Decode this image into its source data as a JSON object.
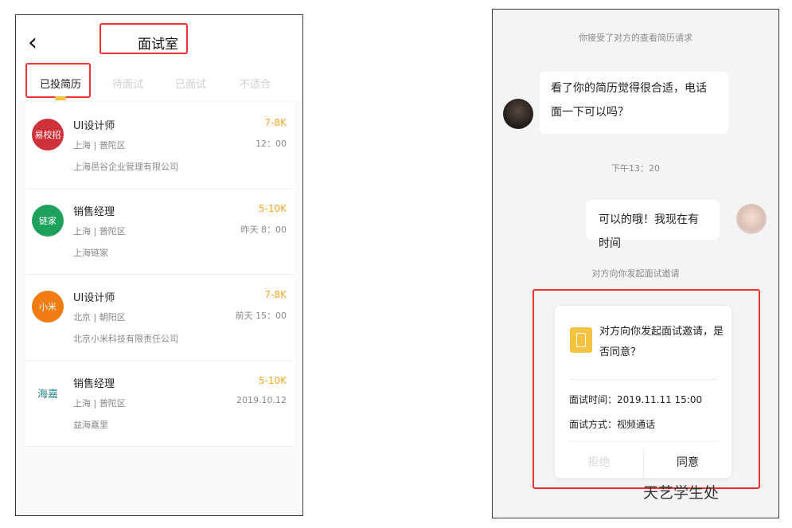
{
  "left_screen": {
    "back_icon": "chevron-left-icon",
    "title": "面试室",
    "tabs": [
      {
        "label": "已投简历",
        "active": true
      },
      {
        "label": "待面试",
        "active": false
      },
      {
        "label": "已面试",
        "active": false
      },
      {
        "label": "不适合",
        "active": false
      }
    ],
    "jobs": [
      {
        "title": "UI设计师",
        "salary": "7-8K",
        "location": "上海 | 普陀区",
        "time": "12：00",
        "company": "上海邑谷企业管理有限公司",
        "logo_text": "易校招",
        "logo_color": "#d0323a"
      },
      {
        "title": "销售经理",
        "salary": "5-10K",
        "location": "上海 | 普陀区",
        "time": "昨天 8：00",
        "company": "上海链家",
        "logo_text": "链家",
        "logo_color": "#1ea25b"
      },
      {
        "title": "UI设计师",
        "salary": "7-8K",
        "location": "北京 | 朝阳区",
        "time": "前天 15：00",
        "company": "北京小米科技有限责任公司",
        "logo_text": "小米",
        "logo_color": "#f07c12"
      },
      {
        "title": "销售经理",
        "salary": "5-10K",
        "location": "上海 | 普陀区",
        "time": "2019.10.12",
        "company": "益海嘉里",
        "logo_text": "海嘉",
        "logo_color": "#2a8a8a"
      }
    ]
  },
  "right_screen": {
    "system_msg_1": "你接受了对方的查看简历请求",
    "incoming_msg": "看了你的简历觉得很合适，电话面一下可以吗？",
    "timestamp": "下午13：20",
    "outgoing_msg": "可以的哦！我现在有时间",
    "system_msg_2": "对方向你发起面试邀请",
    "invite": {
      "question": "对方向你发起面试邀请，是否同意？",
      "time_line": "面试时间：2019.11.11  15:00",
      "method_line": "面试方式：视频通话",
      "reject_label": "拒绝",
      "accept_label": "同意"
    },
    "watermark": "天艺学生处"
  }
}
